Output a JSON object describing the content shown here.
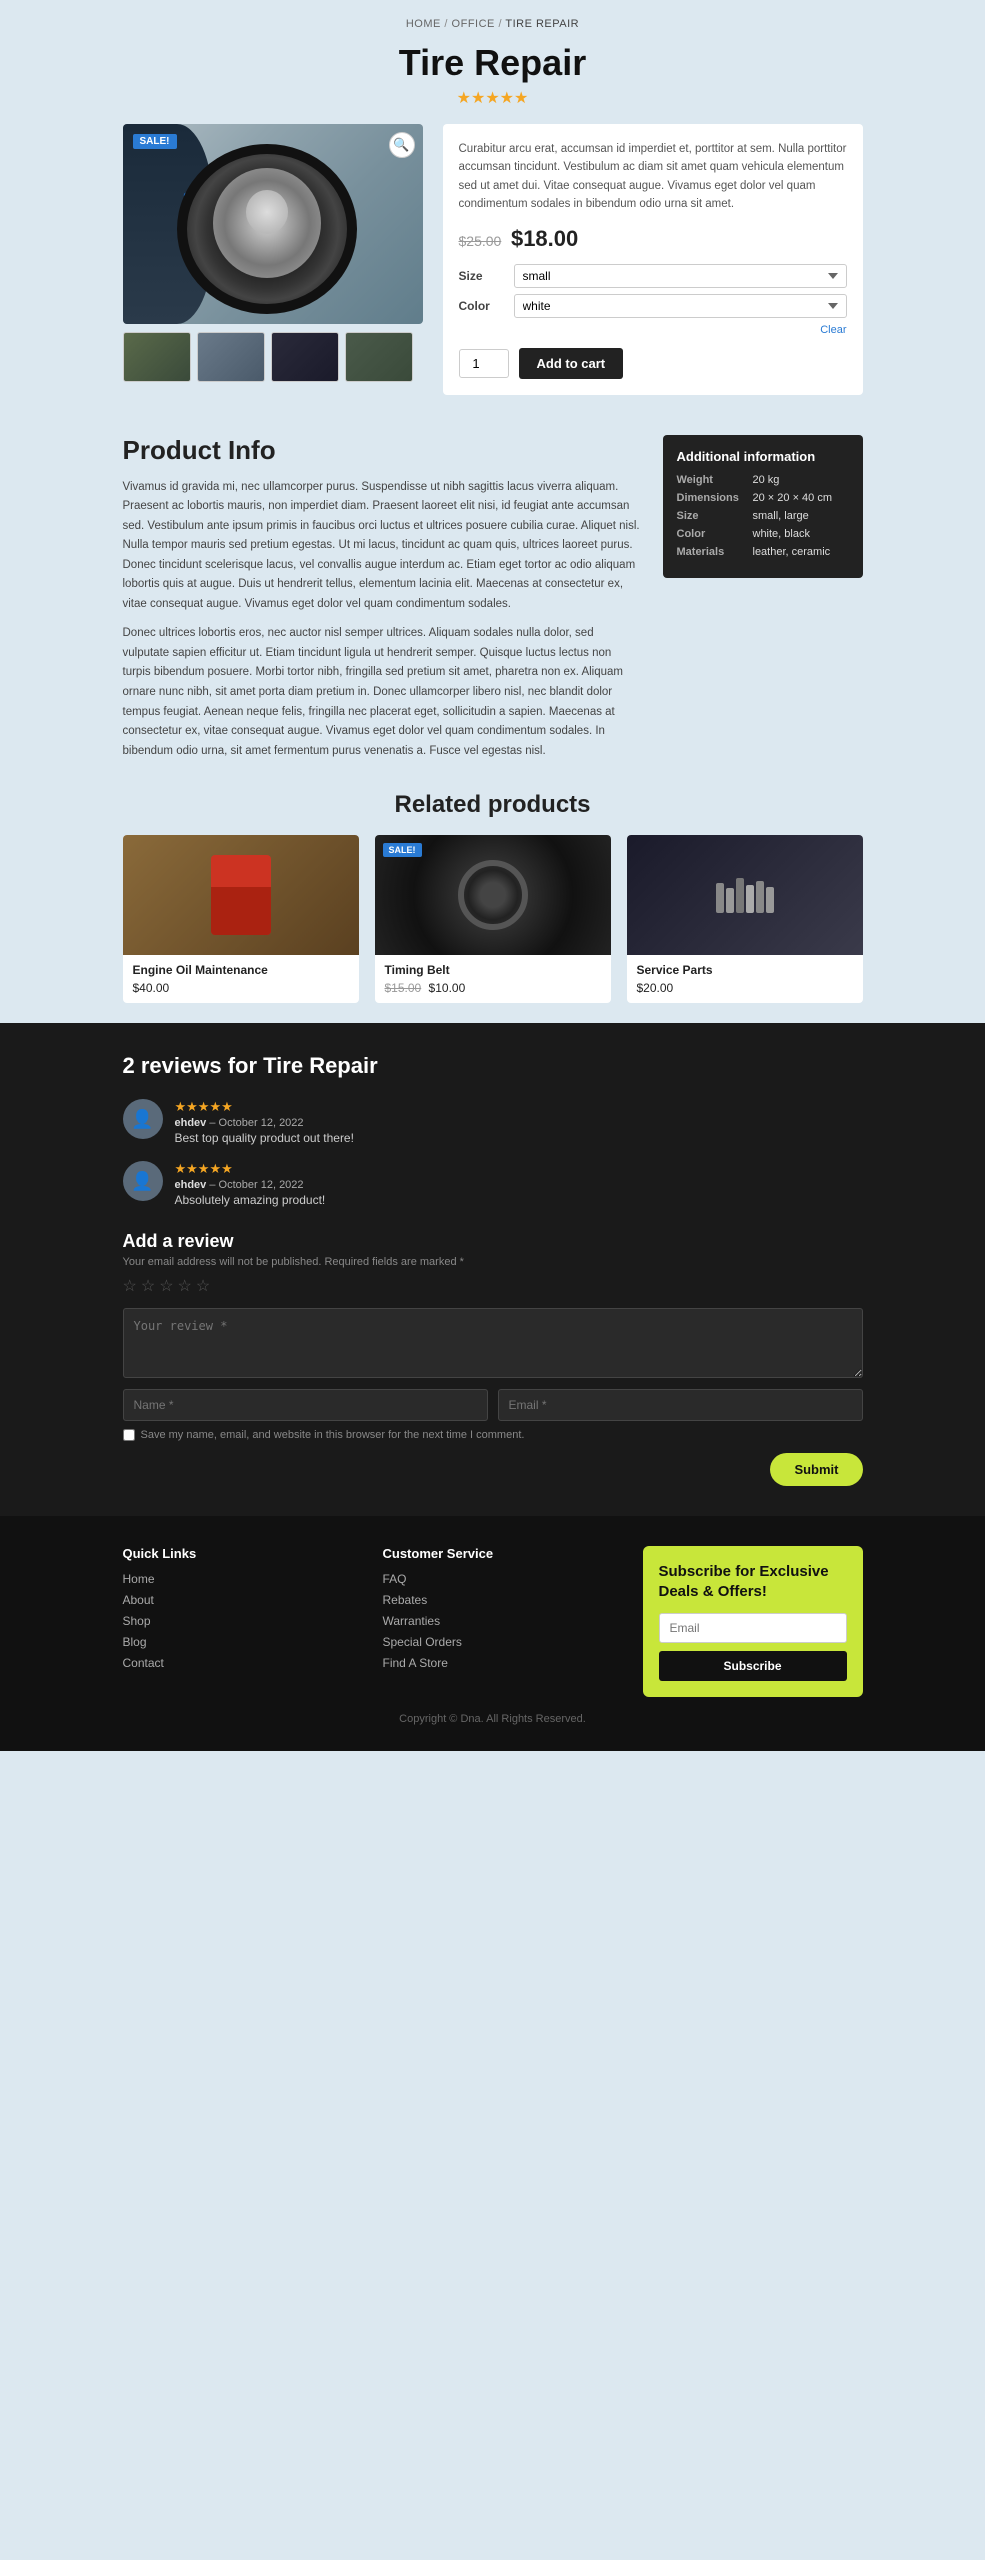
{
  "breadcrumb": {
    "items": [
      "HOME",
      "OFFICE",
      "TIRE REPAIR"
    ]
  },
  "product": {
    "title": "Tire Repair",
    "stars": "★★★★★",
    "sale_badge": "SALE!",
    "description": "Curabitur arcu erat, accumsan id imperdiet et, porttitor at sem. Nulla porttitor accumsan tincidunt. Vestibulum ac diam sit amet quam vehicula elementum sed ut amet dui. Vitae consequat augue. Vivamus eget dolor vel quam condimentum sodales in bibendum odio urna sit amet.",
    "original_price": "$25.00",
    "sale_price": "$18.00",
    "size_label": "Size",
    "size_value": "small",
    "color_label": "Color",
    "color_value": "white",
    "clear_label": "Clear",
    "qty_label": "1",
    "add_to_cart_label": "Add to cart"
  },
  "product_info": {
    "title": "Product Info",
    "text1": "Vivamus id gravida mi, nec ullamcorper purus. Suspendisse ut nibh sagittis lacus viverra aliquam. Praesent ac lobortis mauris, non imperdiet diam. Praesent laoreet elit nisi, id feugiat ante accumsan sed. Vestibulum ante ipsum primis in faucibus orci luctus et ultrices posuere cubilia curae. Aliquet nisl. Nulla tempor mauris sed pretium egestas. Ut mi lacus, tincidunt ac quam quis, ultrices laoreet purus. Donec tincidunt scelerisque lacus, vel convallis augue interdum ac. Etiam eget tortor ac odio aliquam lobortis quis at augue. Duis ut hendrerit tellus, elementum lacinia elit. Maecenas at consectetur ex, vitae consequat augue. Vivamus eget dolor vel quam condimentum sodales.",
    "text2": "Donec ultrices lobortis eros, nec auctor nisl semper ultrices. Aliquam sodales nulla dolor, sed vulputate sapien efficitur ut. Etiam tincidunt ligula ut hendrerit semper. Quisque luctus lectus non turpis bibendum posuere. Morbi tortor nibh, fringilla sed pretium sit amet, pharetra non ex. Aliquam ornare nunc nibh, sit amet porta diam pretium in. Donec ullamcorper libero nisl, nec blandit dolor tempus feugiat. Aenean neque felis, fringilla nec placerat eget, sollicitudin a sapien. Maecenas at consectetur ex, vitae consequat augue. Vivamus eget dolor vel quam condimentum sodales. In bibendum odio urna, sit amet fermentum purus venenatis a. Fusce vel egestas nisl.",
    "additional_title": "Additional information",
    "weight_label": "Weight",
    "weight_val": "20 kg",
    "dimensions_label": "Dimensions",
    "dimensions_val": "20 × 20 × 40 cm",
    "size_label": "Size",
    "size_val": "small, large",
    "color_label": "Color",
    "color_val": "white, black",
    "materials_label": "Materials",
    "materials_val": "leather, ceramic"
  },
  "related": {
    "title": "Related products",
    "products": [
      {
        "name": "Engine Oil Maintenance",
        "price": "$40.00",
        "sale": false
      },
      {
        "name": "Timing Belt",
        "original_price": "$15.00",
        "price": "$10.00",
        "sale": true
      },
      {
        "name": "Service Parts",
        "price": "$20.00",
        "sale": false
      }
    ]
  },
  "reviews": {
    "title": "2 reviews for Tire Repair",
    "items": [
      {
        "user": "ehdev",
        "date": "October 12, 2022",
        "stars": "★★★★★",
        "text": "Best top quality product out there!"
      },
      {
        "user": "ehdev",
        "date": "October 12, 2022",
        "stars": "★★★★★",
        "text": "Absolutely amazing product!"
      }
    ],
    "add_title": "Add a review",
    "note": "Your email address will not be published. Required fields are marked *",
    "review_placeholder": "Your review *",
    "name_placeholder": "Name *",
    "email_placeholder": "Email *",
    "checkbox_label": "Save my name, email, and website in this browser for the next time I comment.",
    "submit_label": "Submit"
  },
  "footer": {
    "quick_links_title": "Quick Links",
    "quick_links": [
      "Home",
      "About",
      "Shop",
      "Blog",
      "Contact"
    ],
    "customer_service_title": "Customer Service",
    "customer_service": [
      "FAQ",
      "Rebates",
      "Warranties",
      "Special Orders",
      "Find A Store"
    ],
    "subscribe_title": "Subscribe for Exclusive Deals & Offers!",
    "email_placeholder": "Email",
    "subscribe_btn": "Subscribe",
    "copyright": "Copyright © Dna. All Rights Reserved."
  }
}
